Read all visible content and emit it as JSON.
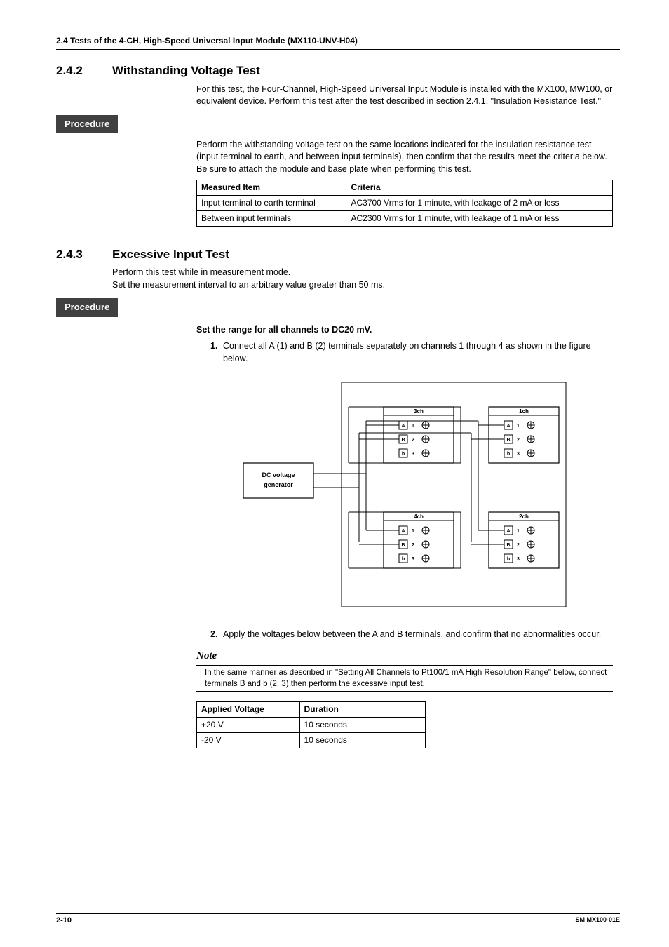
{
  "header": "2.4  Tests of the 4-CH, High-Speed Universal Input Module (MX110-UNV-H04)",
  "s242": {
    "num": "2.4.2",
    "title": "Withstanding Voltage Test",
    "intro": "For this test, the Four-Channel, High-Speed Universal Input Module is installed with the MX100, MW100, or equivalent device. Perform this test after the test described in section 2.4.1, \"Insulation Resistance Test.\"",
    "proc_label": "Procedure",
    "proc_text1": "Perform the withstanding voltage test on the same locations indicated for the insulation resistance test (input terminal to earth, and between input terminals), then confirm that the results meet the criteria below.",
    "proc_text2": "Be sure to attach the module and base plate when performing this test.",
    "table": {
      "h1": "Measured Item",
      "h2": "Criteria",
      "r1c1": "Input terminal to earth terminal",
      "r1c2": "AC3700 Vrms for 1 minute, with leakage of 2 mA or less",
      "r2c1": "Between input terminals",
      "r2c2": "AC2300 Vrms for 1 minute, with leakage of 1 mA or less"
    }
  },
  "s243": {
    "num": "2.4.3",
    "title": "Excessive Input Test",
    "intro1": "Perform this test while in measurement mode.",
    "intro2": "Set the measurement interval to an arbitrary value greater than 50 ms.",
    "proc_label": "Procedure",
    "sub": "Set the range for all channels to DC20 mV.",
    "step1_n": "1.",
    "step1": "Connect all A (1) and B (2) terminals separately on channels 1 through 4 as shown in the figure below.",
    "step2_n": "2.",
    "step2": "Apply the voltages below between the A and B terminals, and confirm that no abnormalities occur.",
    "note_label": "Note",
    "note": "In the same manner as described in \"Setting All Channels to Pt100/1 mA High Resolution Range\" below, connect terminals B and b (2, 3) then perform the excessive input test.",
    "table": {
      "h1": "Applied Voltage",
      "h2": "Duration",
      "r1c1": "+20 V",
      "r1c2": "10 seconds",
      "r2c1": "-20 V",
      "r2c2": "10 seconds"
    }
  },
  "diagram": {
    "gen_l1": "DC voltage",
    "gen_l2": "generator",
    "ch1": "1ch",
    "ch2": "2ch",
    "ch3": "3ch",
    "ch4": "4ch",
    "A": "A",
    "B": "B",
    "b": "b",
    "n1": "1",
    "n2": "2",
    "n3": "3"
  },
  "footer": {
    "page": "2-10",
    "doc": "SM MX100-01E"
  }
}
